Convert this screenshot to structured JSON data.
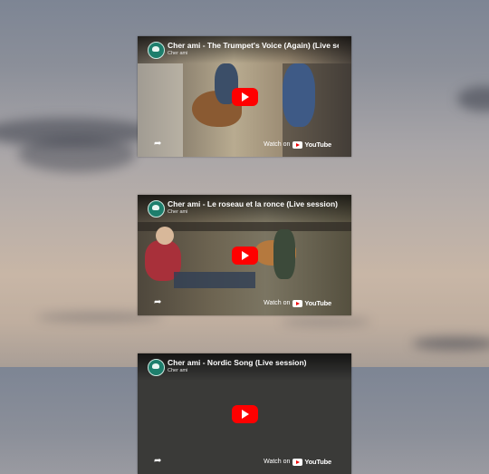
{
  "videos": [
    {
      "title": "Cher ami - The Trumpet's Voice (Again) (Live sess",
      "channel": "Cher ami",
      "watch_label": "Watch on",
      "brand": "YouTube"
    },
    {
      "title": "Cher ami - Le roseau et la ronce (Live session)",
      "channel": "Cher ami",
      "watch_label": "Watch on",
      "brand": "YouTube"
    },
    {
      "title": "Cher ami - Nordic Song (Live session)",
      "channel": "Cher ami",
      "watch_label": "Watch on",
      "brand": "YouTube"
    }
  ],
  "icons": {
    "play": "play-icon",
    "share": "share-icon",
    "youtube": "youtube-icon",
    "channel": "channel-avatar-icon"
  },
  "colors": {
    "play_button": "#ff0000"
  }
}
